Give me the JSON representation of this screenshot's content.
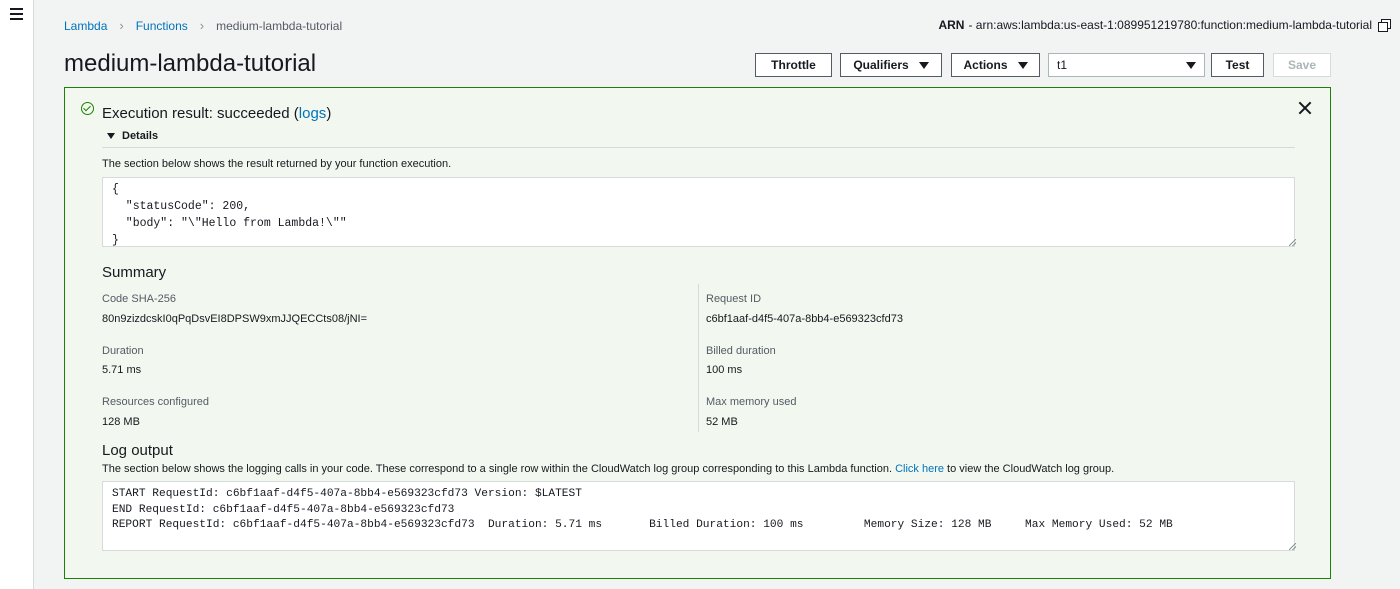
{
  "breadcrumb": {
    "items": [
      "Lambda",
      "Functions"
    ],
    "current": "medium-lambda-tutorial"
  },
  "arn": {
    "label": "ARN",
    "value": "- arn:aws:lambda:us-east-1:089951219780:function:medium-lambda-tutorial"
  },
  "page_title": "medium-lambda-tutorial",
  "toolbar": {
    "throttle": "Throttle",
    "qualifiers": "Qualifiers",
    "actions": "Actions",
    "test_event": "t1",
    "test": "Test",
    "save": "Save"
  },
  "result": {
    "title_prefix": "Execution result: succeeded (",
    "logs_link": "logs",
    "title_suffix": ")",
    "details": "Details",
    "result_desc": "The section below shows the result returned by your function execution.",
    "result_code": "{\n  \"statusCode\": 200,\n  \"body\": \"\\\"Hello from Lambda!\\\"\"\n}",
    "summary_heading": "Summary",
    "summary": {
      "code_sha_label": "Code SHA-256",
      "code_sha_value": "80n9zizdcskI0qPqDsvEI8DPSW9xmJJQECCts08/jNI=",
      "request_id_label": "Request ID",
      "request_id_value": "c6bf1aaf-d4f5-407a-8bb4-e569323cfd73",
      "duration_label": "Duration",
      "duration_value": "5.71 ms",
      "billed_label": "Billed duration",
      "billed_value": "100 ms",
      "resources_label": "Resources configured",
      "resources_value": "128 MB",
      "max_mem_label": "Max memory used",
      "max_mem_value": "52 MB"
    },
    "log_heading": "Log output",
    "log_desc_prefix": "The section below shows the logging calls in your code. These correspond to a single row within the CloudWatch log group corresponding to this Lambda function.",
    "log_link": "Click here",
    "log_desc_suffix": "to view the CloudWatch log group.",
    "log_text": "START RequestId: c6bf1aaf-d4f5-407a-8bb4-e569323cfd73 Version: $LATEST\nEND RequestId: c6bf1aaf-d4f5-407a-8bb4-e569323cfd73\nREPORT RequestId: c6bf1aaf-d4f5-407a-8bb4-e569323cfd73  Duration: 5.71 ms       Billed Duration: 100 ms         Memory Size: 128 MB     Max Memory Used: 52 MB"
  },
  "colors": {
    "success": "#1d8102",
    "link": "#0073bb",
    "panel_bg": "#f2f8f0",
    "page_bg": "#f2f3f3"
  }
}
